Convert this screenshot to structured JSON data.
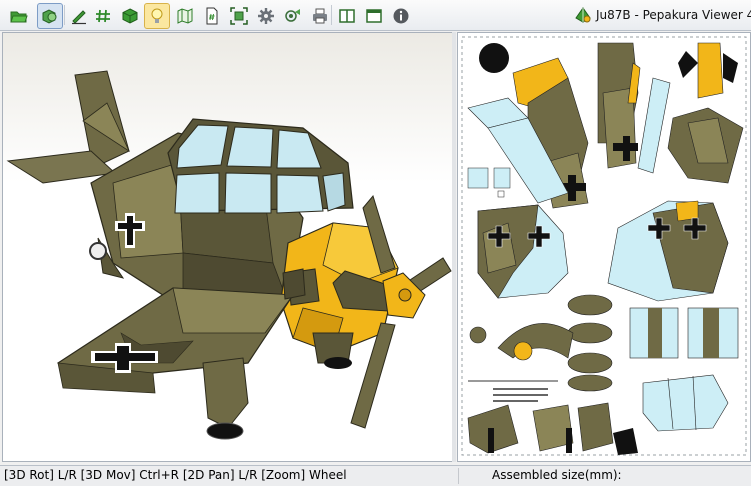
{
  "window": {
    "title": "Ju87B - Pepakura Viewer 4"
  },
  "toolbar": {
    "buttons": [
      {
        "name": "open-file",
        "icon": "folder-open-icon",
        "state": "normal"
      },
      {
        "name": "3d-view-mode",
        "icon": "3d-shapes-icon",
        "state": "pressed"
      },
      {
        "name": "draw-edge",
        "icon": "pen-edge-icon",
        "state": "normal"
      },
      {
        "name": "edge-id",
        "icon": "hash-icon",
        "state": "normal"
      },
      {
        "name": "show-3d-model",
        "icon": "green-cube-icon",
        "state": "normal"
      },
      {
        "name": "light",
        "icon": "lightbulb-icon",
        "state": "active"
      },
      {
        "name": "unfold-map",
        "icon": "map-icon",
        "state": "normal"
      },
      {
        "name": "page-numbers",
        "icon": "page-number-icon",
        "state": "normal"
      },
      {
        "name": "fit-view",
        "icon": "fit-icon",
        "state": "normal"
      },
      {
        "name": "settings",
        "icon": "gear-icon",
        "state": "normal"
      },
      {
        "name": "view-options",
        "icon": "eye-icon",
        "state": "normal"
      },
      {
        "name": "print",
        "icon": "printer-icon",
        "state": "normal"
      },
      {
        "name": "split-view",
        "icon": "split-window-icon",
        "state": "normal"
      },
      {
        "name": "single-view",
        "icon": "window-icon",
        "state": "normal"
      },
      {
        "name": "info",
        "icon": "info-icon",
        "state": "normal"
      }
    ]
  },
  "views": {
    "model3d": {
      "subject": "Ju 87 papercraft aircraft",
      "marking": "balkenkreuz"
    },
    "pattern2d": {
      "page_note": "Pepakura pattern sheet"
    }
  },
  "statusbar": {
    "hint": "[3D Rot] L/R [3D Mov] Ctrl+R [2D Pan] L/R [Zoom] Wheel",
    "assembled_label": "Assembled size(mm):"
  },
  "colors": {
    "olive": "#6f6a45",
    "olive_dark": "#5a5638",
    "olive_light": "#8b8557",
    "yellow": "#f2b619",
    "canopy": "#c9e9f2",
    "pattern_blue": "#cdeef6",
    "black": "#111111"
  }
}
